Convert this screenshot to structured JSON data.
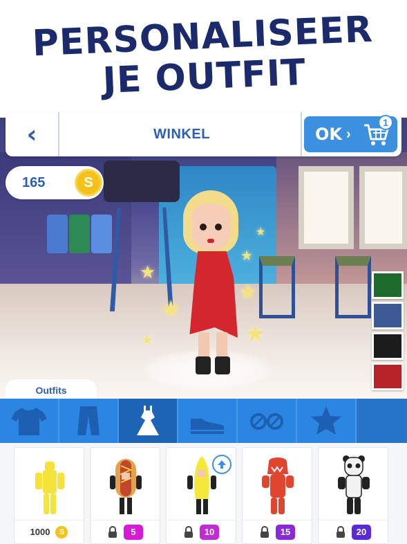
{
  "headline": {
    "line1": "PERSONALISEER",
    "line2": "JE OUTFIT"
  },
  "topbar": {
    "title": "WINKEL",
    "back_icon": "chevron-left-icon",
    "ok_label": "OK",
    "cart_icon": "shopping-cart-icon",
    "cart_count": "1"
  },
  "coins": {
    "amount": "165",
    "icon_letter": "S"
  },
  "colors": [
    "#1f6b2e",
    "#3d5a96",
    "#1b1b1b",
    "#b8232a"
  ],
  "outfits_label": "Outfits",
  "categories": [
    {
      "name": "shirts",
      "icon": "tshirt-icon"
    },
    {
      "name": "pants",
      "icon": "pants-icon"
    },
    {
      "name": "dresses",
      "icon": "dress-icon",
      "active": true
    },
    {
      "name": "shoes",
      "icon": "shoe-icon"
    },
    {
      "name": "glasses",
      "icon": "glasses-icon"
    },
    {
      "name": "special",
      "icon": "star-icon"
    }
  ],
  "items": [
    {
      "price": "1000",
      "coin_letter": "S",
      "locked": false
    },
    {
      "level": "5",
      "locked": true,
      "badge_color": "#d61bd6"
    },
    {
      "level": "10",
      "locked": true,
      "badge_color": "#c22ad6",
      "upgrade": true
    },
    {
      "level": "15",
      "locked": true,
      "badge_color": "#8a2ad6"
    },
    {
      "level": "20",
      "locked": true,
      "badge_color": "#5a2ad6"
    }
  ]
}
